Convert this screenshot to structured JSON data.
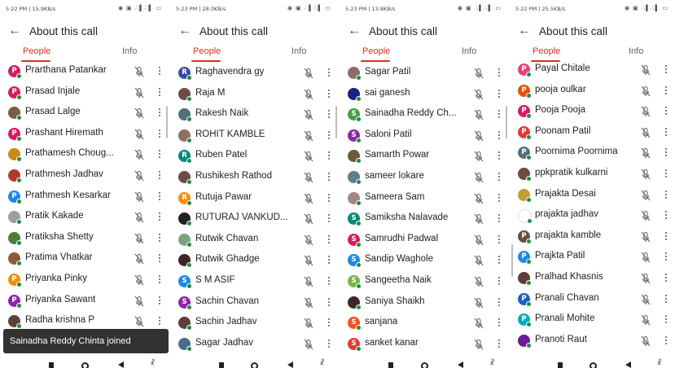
{
  "panels": [
    {
      "time": "5:22 PM | 15.9KB/s",
      "title": "About this call",
      "tabs": {
        "people": "People",
        "info": "Info"
      },
      "toast": "Sainadha Reddy Chinta joined",
      "participants": [
        {
          "name": "Prarthana Patankar",
          "initial": "P",
          "color": "#d81b60"
        },
        {
          "name": "Prasad Injale",
          "initial": "P",
          "color": "#d81b60"
        },
        {
          "name": "Prasad Lalge",
          "initial": "",
          "color": "#7b5e3b"
        },
        {
          "name": "Prashant Hiremath",
          "initial": "P",
          "color": "#d81b60"
        },
        {
          "name": "Prathamesh Choug...",
          "initial": "",
          "color": "#c98a1a"
        },
        {
          "name": "Prathmesh Jadhav",
          "initial": "",
          "color": "#b23a2a"
        },
        {
          "name": "Prathmesh Kesarkar",
          "initial": "P",
          "color": "#1e88e5"
        },
        {
          "name": "Pratik Kakade",
          "initial": "",
          "color": "#9e9e9e"
        },
        {
          "name": "Pratiksha Shetty",
          "initial": "",
          "color": "#4e7d3a"
        },
        {
          "name": "Pratima Vhatkar",
          "initial": "",
          "color": "#8d5a3b"
        },
        {
          "name": "Priyanka Pinky",
          "initial": "P",
          "color": "#fb8c00"
        },
        {
          "name": "Priyanka Sawant",
          "initial": "P",
          "color": "#8e24aa"
        },
        {
          "name": "Radha krishna P",
          "initial": "",
          "color": "#5d4037"
        }
      ]
    },
    {
      "time": "5:23 PM | 28.0KB/s",
      "title": "About this call",
      "tabs": {
        "people": "People",
        "info": "Info"
      },
      "participants": [
        {
          "name": "Raghavendra gy",
          "initial": "R",
          "color": "#3949ab"
        },
        {
          "name": "Raja M",
          "initial": "",
          "color": "#6d4c41"
        },
        {
          "name": "Rakesh Naik",
          "initial": "",
          "color": "#546e7a"
        },
        {
          "name": "ROHIT KAMBLE",
          "initial": "",
          "color": "#8d6e63"
        },
        {
          "name": "Ruben Patel",
          "initial": "R",
          "color": "#00897b"
        },
        {
          "name": "Rushikesh Rathod",
          "initial": "",
          "color": "#6d4c41"
        },
        {
          "name": "Rutuja Pawar",
          "initial": "R",
          "color": "#fb8c00"
        },
        {
          "name": "RUTURAJ VANKUD...",
          "initial": "",
          "color": "#212121"
        },
        {
          "name": "Rutwik Chavan",
          "initial": "",
          "color": "#7aa37a"
        },
        {
          "name": "Rutwik Ghadge",
          "initial": "",
          "color": "#3e2723"
        },
        {
          "name": "S M ASIF",
          "initial": "S",
          "color": "#1e88e5"
        },
        {
          "name": "Sachin Chavan",
          "initial": "S",
          "color": "#8e24aa"
        },
        {
          "name": "Sachin Jadhav",
          "initial": "",
          "color": "#5d4037"
        },
        {
          "name": "Sagar Jadhav",
          "initial": "",
          "color": "#4e6a8a"
        }
      ]
    },
    {
      "time": "5:23 PM | 13.8KB/s",
      "title": "About this call",
      "tabs": {
        "people": "People",
        "info": "Info"
      },
      "participants": [
        {
          "name": "Sagar Patil",
          "initial": "",
          "color": "#8d6e63"
        },
        {
          "name": "sai ganesh",
          "initial": "",
          "color": "#1a237e"
        },
        {
          "name": "Sainadha Reddy Ch...",
          "initial": "S",
          "color": "#43a047"
        },
        {
          "name": "Saloni Patil",
          "initial": "S",
          "color": "#8e24aa"
        },
        {
          "name": "Samarth Powar",
          "initial": "",
          "color": "#6d5a3b"
        },
        {
          "name": "sameer lokare",
          "initial": "",
          "color": "#607d8b"
        },
        {
          "name": "Sameera Sam",
          "initial": "",
          "color": "#a1887f"
        },
        {
          "name": "Samiksha Nalavade",
          "initial": "S",
          "color": "#00897b"
        },
        {
          "name": "Samrudhi Padwal",
          "initial": "S",
          "color": "#d81b60"
        },
        {
          "name": "Sandip Waghole",
          "initial": "S",
          "color": "#1e88e5"
        },
        {
          "name": "Sangeetha Naik",
          "initial": "S",
          "color": "#7cb342"
        },
        {
          "name": "Saniya Shaikh",
          "initial": "",
          "color": "#3e2723"
        },
        {
          "name": "sanjana",
          "initial": "S",
          "color": "#f4511e"
        },
        {
          "name": "sanket kanar",
          "initial": "S",
          "color": "#e53935"
        }
      ]
    },
    {
      "time": "5:22 PM | 25.5KB/s",
      "title": "About this call",
      "tabs": {
        "people": "People",
        "info": "Info"
      },
      "participants": [
        {
          "name": "Payal Chitale",
          "initial": "P",
          "color": "#ec407a"
        },
        {
          "name": "pooja oulkar",
          "initial": "P",
          "color": "#e65100"
        },
        {
          "name": "Pooja Pooja",
          "initial": "P",
          "color": "#d81b60"
        },
        {
          "name": "Poonam Patil",
          "initial": "P",
          "color": "#e53935"
        },
        {
          "name": "Poornima Poornima",
          "initial": "P",
          "color": "#546e7a"
        },
        {
          "name": "ppkpratik kulkarni",
          "initial": "",
          "color": "#6d4c41"
        },
        {
          "name": "Prajakta Desai",
          "initial": "",
          "color": "#c0a030"
        },
        {
          "name": "prajakta jadhav",
          "initial": "",
          "color": "#ffffff"
        },
        {
          "name": "prajakta kamble",
          "initial": "P",
          "color": "#6d4c41"
        },
        {
          "name": "Prajkta Patil",
          "initial": "P",
          "color": "#1e88e5"
        },
        {
          "name": "Pralhad Khasnis",
          "initial": "",
          "color": "#5d4037"
        },
        {
          "name": "Pranali Chavan",
          "initial": "P",
          "color": "#1565c0"
        },
        {
          "name": "Pranali Mohite",
          "initial": "P",
          "color": "#00acc1"
        },
        {
          "name": "Pranoti Raut",
          "initial": "",
          "color": "#6a1b9a"
        }
      ]
    }
  ]
}
